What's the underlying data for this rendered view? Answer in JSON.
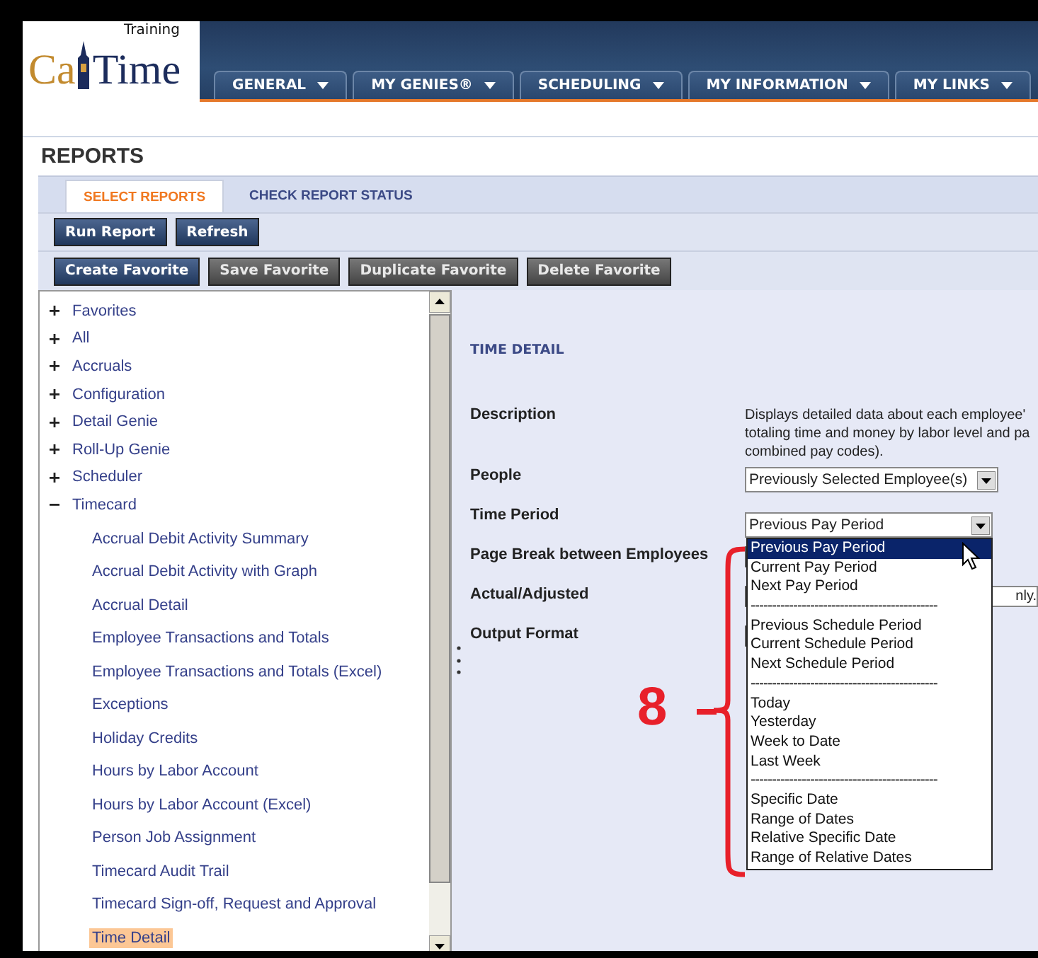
{
  "logo": {
    "left": "Ca",
    "right": "Time",
    "tag": "Training"
  },
  "nav": [
    {
      "label": "GENERAL"
    },
    {
      "label": "MY GENIES®"
    },
    {
      "label": "SCHEDULING"
    },
    {
      "label": "MY INFORMATION"
    },
    {
      "label": "MY LINKS"
    }
  ],
  "page_title": "REPORTS",
  "tabs": [
    {
      "label": "SELECT REPORTS",
      "selected": true
    },
    {
      "label": "CHECK REPORT STATUS",
      "selected": false
    }
  ],
  "toolbar_1": [
    {
      "label": "Run Report",
      "kind": "primary"
    },
    {
      "label": "Refresh",
      "kind": "primary"
    }
  ],
  "toolbar_2": [
    {
      "label": "Create Favorite",
      "kind": "primary"
    },
    {
      "label": "Save Favorite",
      "kind": "secondary"
    },
    {
      "label": "Duplicate Favorite",
      "kind": "secondary"
    },
    {
      "label": "Delete Favorite",
      "kind": "secondary"
    }
  ],
  "tree": [
    {
      "label": "Favorites",
      "expanded": false
    },
    {
      "label": "All",
      "expanded": false
    },
    {
      "label": "Accruals",
      "expanded": false
    },
    {
      "label": "Configuration",
      "expanded": false
    },
    {
      "label": "Detail Genie",
      "expanded": false
    },
    {
      "label": "Roll-Up Genie",
      "expanded": false
    },
    {
      "label": "Scheduler",
      "expanded": false
    },
    {
      "label": "Timecard",
      "expanded": true,
      "children": [
        {
          "label": "Accrual Debit Activity Summary",
          "selected": false
        },
        {
          "label": "Accrual Debit Activity with Graph",
          "selected": false
        },
        {
          "label": "Accrual Detail",
          "selected": false
        },
        {
          "label": "Employee Transactions and Totals",
          "selected": false
        },
        {
          "label": "Employee Transactions and Totals (Excel)",
          "selected": false
        },
        {
          "label": "Exceptions",
          "selected": false
        },
        {
          "label": "Holiday Credits",
          "selected": false
        },
        {
          "label": "Hours by Labor Account",
          "selected": false
        },
        {
          "label": "Hours by Labor Account (Excel)",
          "selected": false
        },
        {
          "label": "Person Job Assignment",
          "selected": false
        },
        {
          "label": "Timecard Audit Trail",
          "selected": false
        },
        {
          "label": "Timecard Sign-off, Request and Approval",
          "selected": false
        },
        {
          "label": "Time Detail",
          "selected": true
        }
      ]
    }
  ],
  "detail": {
    "heading": "TIME DETAIL",
    "fields": [
      {
        "label": "Description",
        "kind": "text",
        "lines": [
          "Displays detailed data about each employee'",
          "totaling time and money by labor level and pa",
          "combined pay codes)."
        ]
      },
      {
        "label": "People",
        "kind": "select",
        "value": "Previously Selected Employee(s)"
      },
      {
        "label": "Time Period",
        "kind": "select",
        "value": "Previous Pay Period"
      },
      {
        "label": "Page Break between Employees",
        "kind": "covered"
      },
      {
        "label": "Actual/Adjusted",
        "kind": "covered",
        "value": "nly."
      },
      {
        "label": "Output Format",
        "kind": "covered"
      }
    ]
  },
  "dropdown": [
    {
      "kind": "option",
      "label": "Previous Pay Period",
      "selected": true
    },
    {
      "kind": "option",
      "label": "Current Pay Period",
      "selected": false
    },
    {
      "kind": "option",
      "label": "Next Pay Period",
      "selected": false
    },
    {
      "kind": "separator",
      "label": "--------------------------------------------"
    },
    {
      "kind": "option",
      "label": "Previous Schedule Period",
      "selected": false
    },
    {
      "kind": "option",
      "label": "Current Schedule Period",
      "selected": false
    },
    {
      "kind": "option",
      "label": "Next Schedule Period",
      "selected": false
    },
    {
      "kind": "separator",
      "label": "--------------------------------------------"
    },
    {
      "kind": "option",
      "label": "Today",
      "selected": false
    },
    {
      "kind": "option",
      "label": "Yesterday",
      "selected": false
    },
    {
      "kind": "option",
      "label": "Week to Date",
      "selected": false
    },
    {
      "kind": "option",
      "label": "Last Week",
      "selected": false
    },
    {
      "kind": "separator",
      "label": "--------------------------------------------"
    },
    {
      "kind": "option",
      "label": "Specific Date",
      "selected": false
    },
    {
      "kind": "option",
      "label": "Range of Dates",
      "selected": false
    },
    {
      "kind": "option",
      "label": "Relative Specific Date",
      "selected": false
    },
    {
      "kind": "option",
      "label": "Range of Relative Dates",
      "selected": false
    }
  ],
  "annotation": {
    "label": "8"
  }
}
